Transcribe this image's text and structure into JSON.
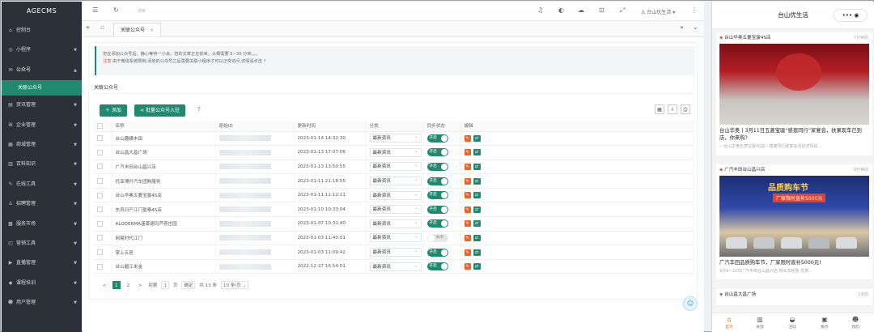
{
  "sidebar": {
    "logo": "AGECMS",
    "items": [
      {
        "label": "控制台",
        "icon": "home-icon",
        "arrow": false
      },
      {
        "label": "小程序",
        "icon": "miniapp-icon",
        "arrow": true
      },
      {
        "label": "公众号",
        "icon": "wechat-icon",
        "arrow": true,
        "open": true
      },
      {
        "label": "资讯管理",
        "icon": "doc-icon",
        "arrow": true
      },
      {
        "label": "企业管理",
        "icon": "company-icon",
        "arrow": true
      },
      {
        "label": "商城管理",
        "icon": "cart-icon",
        "arrow": true
      },
      {
        "label": "百科知识",
        "icon": "book-icon",
        "arrow": true
      },
      {
        "label": "在线工具",
        "icon": "tool-icon",
        "arrow": true
      },
      {
        "label": "招聘管理",
        "icon": "user-icon",
        "arrow": true
      },
      {
        "label": "服务市场",
        "icon": "market-icon",
        "arrow": true
      },
      {
        "label": "营销工具",
        "icon": "gift-icon",
        "arrow": true
      },
      {
        "label": "直播管理",
        "icon": "live-icon",
        "arrow": true
      },
      {
        "label": "课程培训",
        "icon": "course-icon",
        "arrow": true
      },
      {
        "label": "用户管理",
        "icon": "users-icon",
        "arrow": true
      }
    ],
    "sub_active": "关联公众号"
  },
  "topbar": {
    "search_placeholder": "搜索",
    "user": "台山优生活",
    "menu_icon": "menu-icon",
    "refresh_icon": "refresh-icon"
  },
  "tabs": {
    "current": "关联公众号"
  },
  "notice": {
    "line1": "您在添加公众号后，静心等待一小会，您的文章正在抓来，大概需要 5~30 分钟。。。",
    "note_label": "注意",
    "line2": "由于微信系统限制,添加的公众号之后需要关联小程序才可以正常访问,详情请点击",
    "help": "?"
  },
  "section_title": "关联公众号",
  "buttons": {
    "add": "＋ 添加",
    "batch": "批量公众号入驻",
    "help": "?"
  },
  "table": {
    "headers": [
      "名称",
      "原始ID",
      "更新时间",
      "分类",
      "同步状态",
      "编辑"
    ],
    "rows": [
      {
        "name": "台山趣横丰田",
        "time": "2023-01-14 14:32:30",
        "cat": "最新资讯",
        "sync": "开启",
        "on": true
      },
      {
        "name": "台山昌大昌广场",
        "time": "2023-01-13 17:07:06",
        "cat": "最新资讯",
        "sync": "开启",
        "on": true
      },
      {
        "name": "广汽丰田台山昌兴店",
        "time": "2023-01-13 13:50:55",
        "cat": "最新资讯",
        "sync": "开启",
        "on": true
      },
      {
        "name": "托亚博升汽车团购服务",
        "time": "2023-01-11 21:18:55",
        "cat": "最新资讯",
        "sync": "开启",
        "on": true
      },
      {
        "name": "台山华奥五菱宝骏4S店",
        "time": "2023-01-11 11:12:11",
        "cat": "最新资讯",
        "sync": "开启",
        "on": true
      },
      {
        "name": "东风日产江门盈泰4S店",
        "time": "2023-01-10 10:33:04",
        "cat": "最新资讯",
        "sync": "开启",
        "on": true
      },
      {
        "name": "ALODERMA谨慕德玛芦荟庄园",
        "time": "2023-01-07 10:31:40",
        "cat": "最新资讯",
        "sync": "开启",
        "on": true
      },
      {
        "name": "网易时代江门",
        "time": "2023-01-03 11:40:01",
        "cat": "最新资讯",
        "sync": "关闭",
        "on": false
      },
      {
        "name": "掌上五邑",
        "time": "2023-01-03 11:09:42",
        "cat": "最新资讯",
        "sync": "开启",
        "on": true
      },
      {
        "name": "台山碧江未金",
        "time": "2022-12-27 16:54:01",
        "cat": "最新资讯",
        "sync": "开启",
        "on": true
      }
    ]
  },
  "pager": {
    "prev": "<",
    "p1": "1",
    "p2": "2",
    "next": ">",
    "goto": "到第",
    "page": "1",
    "page_unit": "页",
    "confirm": "确定",
    "total": "共 13 条",
    "size": "10 条/页"
  },
  "phone": {
    "title": "台山优生活",
    "caps": "•••  ◉",
    "cards": [
      {
        "source": "台山华奥五菱宝骏4S店",
        "time": "7分钟前",
        "title": "台山华奥丨3月11日五菱宝骏“感恩同行”家宴会，扶果现车已到店，你来购?",
        "sub": "—台山华奥五菱宝骏4S店—感谢同行家宴会活动详情动…"
      },
      {
        "source": "广汽丰田台山昌兴店",
        "time": "9分钟前",
        "banner": "品质购车节",
        "banner2": "厂家限时直补5000元",
        "title": "广汽丰田品质购车节，厂家限时直补5000元!",
        "sub": "3月9~12日广汽丰田台山昌兴店 购车享钜惠 优惠…"
      },
      {
        "source": "台山昌大昌广场",
        "time": "1天前"
      }
    ],
    "tabbar": [
      "首页",
      "发现",
      "活动",
      "服务",
      "我的"
    ]
  }
}
